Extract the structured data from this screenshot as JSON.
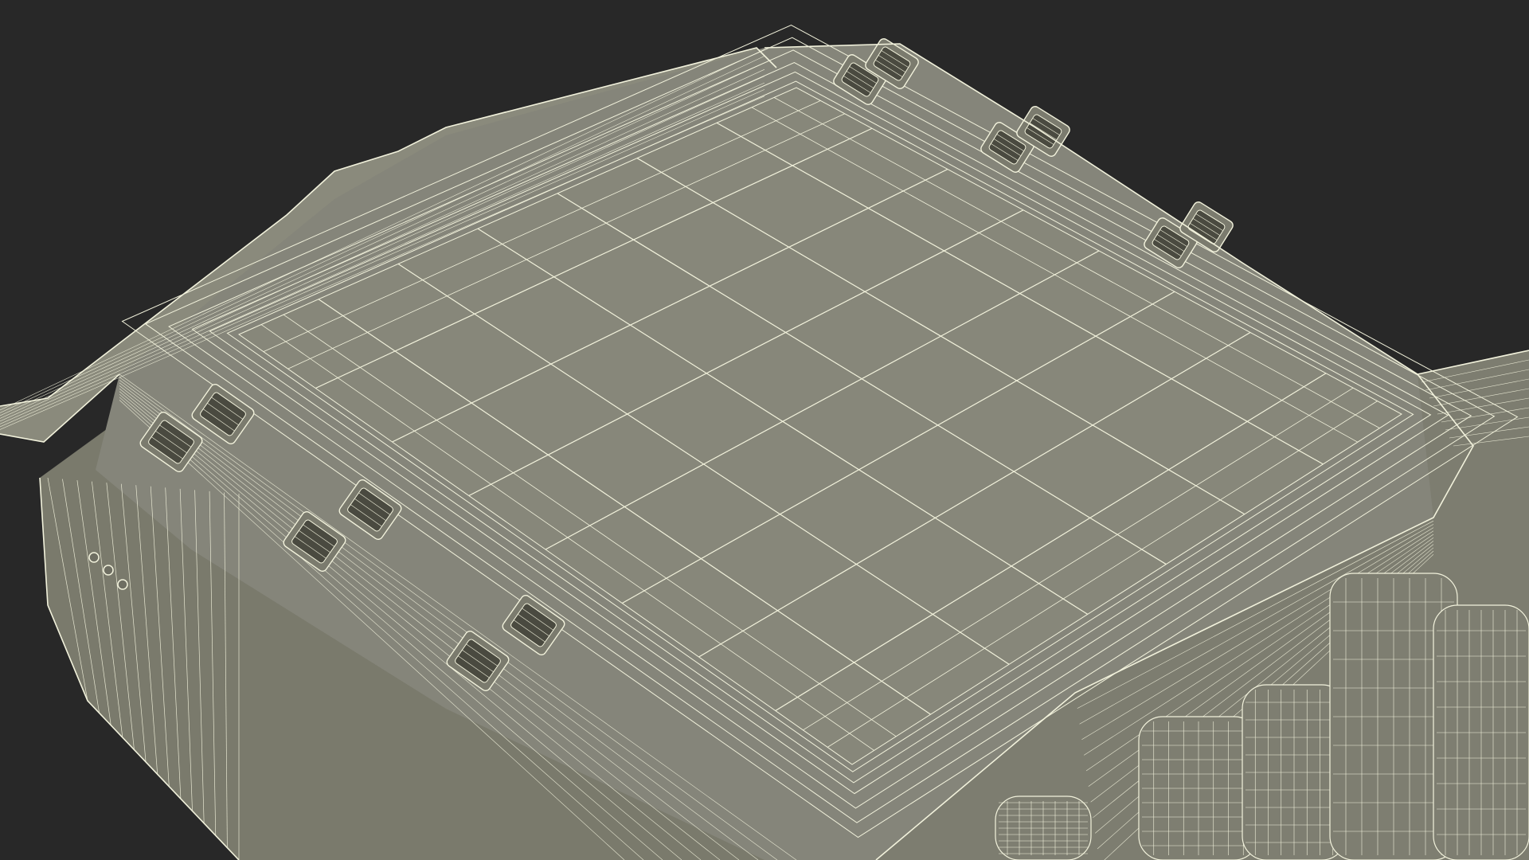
{
  "viewport": {
    "background": "#282828",
    "mesh_fill": "#87877a",
    "mesh_fill_dark": "#6e6e62",
    "wire_color": "#f2f2dc",
    "shadow_color": "#4a4a40"
  },
  "scene": {
    "subject": "wireframe-3d-model",
    "icons": [
      "vent-slot-icon",
      "port-dot-icon"
    ]
  }
}
